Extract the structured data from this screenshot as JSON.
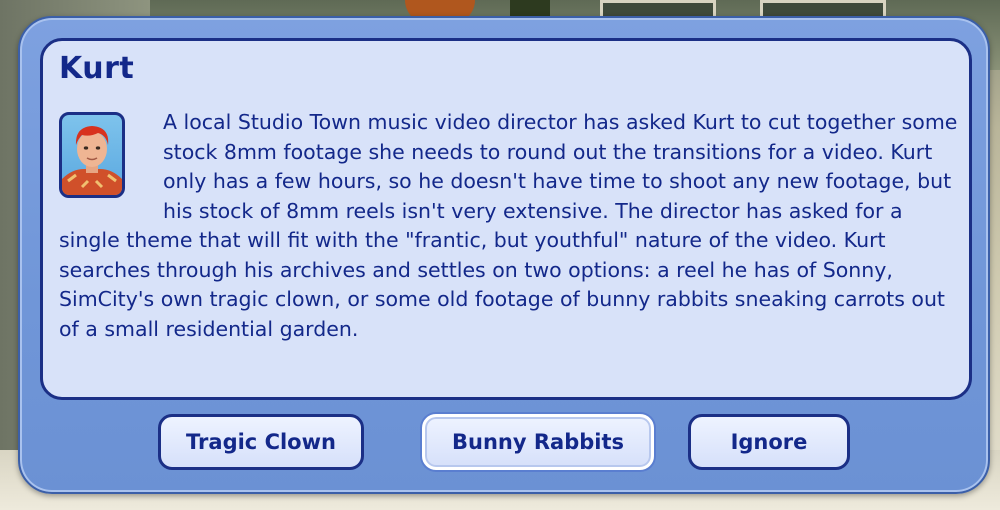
{
  "dialog": {
    "title": "Kurt",
    "portrait_icon": "sim-portrait-icon",
    "message": "A local Studio Town music video director has asked Kurt to cut together some stock 8mm footage she needs to round out the transitions for a video. Kurt only has a few hours, so he doesn't have time to shoot any new footage, but his stock of 8mm reels isn't very extensive. The director has asked for a single theme that will fit with the \"frantic, but youthful\" nature of the video. Kurt searches through his archives and settles on two options: a reel he has of Sonny, SimCity's own tragic clown, or some old footage of bunny rabbits sneaking carrots out of a small residential garden.",
    "buttons": [
      {
        "label": "Tragic Clown"
      },
      {
        "label": "Bunny Rabbits",
        "focused": true
      },
      {
        "label": "Ignore"
      }
    ]
  },
  "colors": {
    "frame": "#7096d8",
    "panel": "#d8e2f9",
    "text": "#13288a",
    "border": "#1b2f86"
  }
}
